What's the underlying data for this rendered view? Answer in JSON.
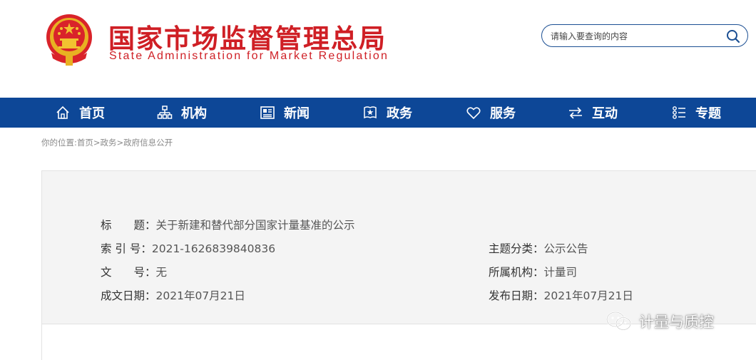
{
  "header": {
    "title_cn": "国家市场监督管理总局",
    "title_en": "State Administration for Market Regulation",
    "search_placeholder": "请输入要查询的内容"
  },
  "nav": {
    "items": [
      {
        "label": "首页",
        "icon": "home-icon"
      },
      {
        "label": "机构",
        "icon": "org-chart-icon"
      },
      {
        "label": "新闻",
        "icon": "newspaper-icon"
      },
      {
        "label": "政务",
        "icon": "government-icon"
      },
      {
        "label": "服务",
        "icon": "heart-icon"
      },
      {
        "label": "互动",
        "icon": "exchange-icon"
      },
      {
        "label": "专题",
        "icon": "list-icon"
      }
    ]
  },
  "breadcrumb": {
    "prefix": "你的位置:",
    "items": [
      "首页",
      "政务",
      "政府信息公开"
    ],
    "separator": ">"
  },
  "info": {
    "title_label": "标　　题：",
    "title_value": "关于新建和替代部分国家计量基准的公示",
    "index_label": "索 引 号：",
    "index_value": "2021-1626839840836",
    "category_label": "主题分类：",
    "category_value": "公示公告",
    "docno_label": "文　　号：",
    "docno_value": "无",
    "org_label": "所属机构：",
    "org_value": "计量司",
    "created_label": "成文日期：",
    "created_value": "2021年07月21日",
    "published_label": "发布日期：",
    "published_value": "2021年07月21日"
  },
  "watermark": {
    "text": "计量与质控",
    "icon": "wechat-icon"
  },
  "colors": {
    "brand_red": "#cf1f25",
    "nav_blue": "#0d4797",
    "panel_bg": "#f4f4f4"
  }
}
